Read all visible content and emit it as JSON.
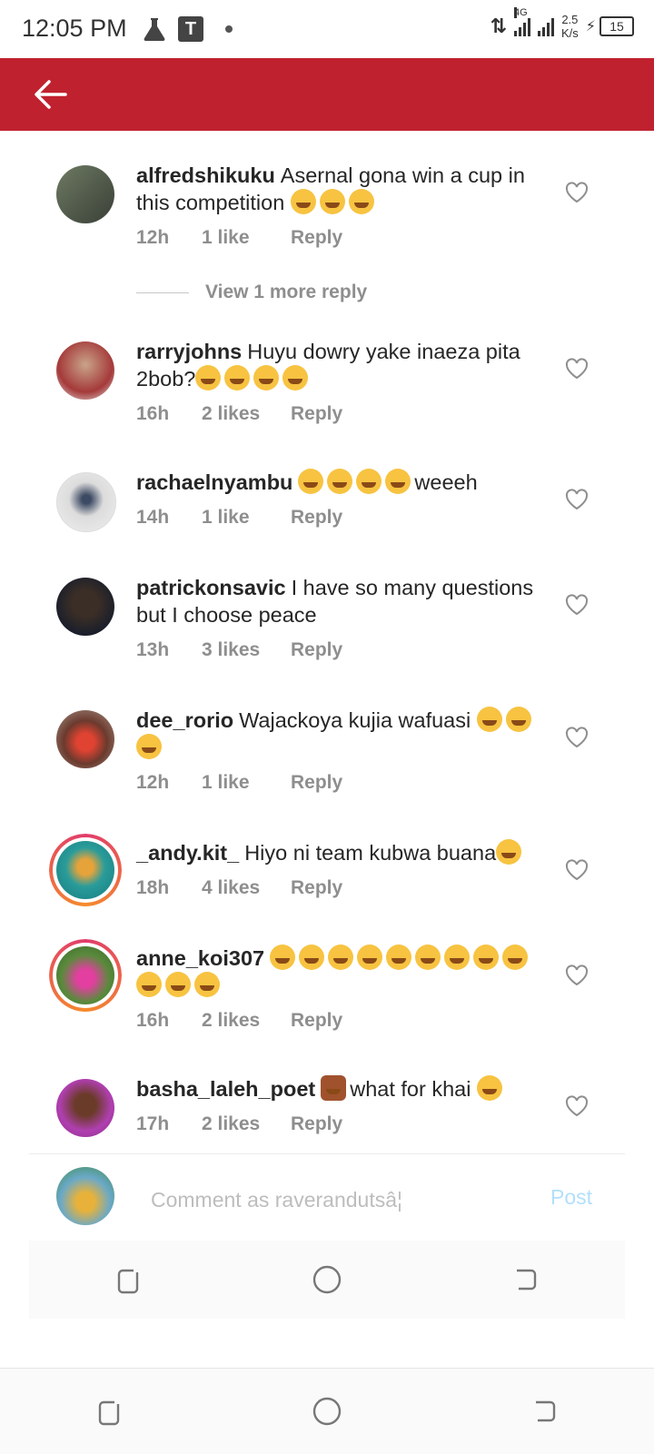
{
  "status_bar": {
    "time": "12:05 PM",
    "network": "4G",
    "speed_value": "2.5",
    "speed_unit": "K/s",
    "battery": "15"
  },
  "header": {
    "back_icon": "arrow-left-icon",
    "background": "#c0212f"
  },
  "comments": [
    {
      "username": "alfredshikuku",
      "text": "Asernal gona win a cup in this competition",
      "emoji_count": 3,
      "time": "12h",
      "likes": "1 like",
      "reply": "Reply"
    },
    {
      "username": "rarryjohns",
      "text": "Huyu dowry yake inaeza pita 2bob?",
      "emoji_count": 4,
      "time": "16h",
      "likes": "2 likes",
      "reply": "Reply"
    },
    {
      "username": "rachaelnyambu",
      "text": "weeeh",
      "emoji_count": 4,
      "emoji_before": true,
      "time": "14h",
      "likes": "1 like",
      "reply": "Reply"
    },
    {
      "username": "patrickonsavic",
      "text": "I have so many questions but  I choose peace",
      "emoji_count": 0,
      "time": "13h",
      "likes": "3 likes",
      "reply": "Reply"
    },
    {
      "username": "dee_rorio",
      "text": "Wajackoya kujia wafuasi",
      "emoji_count": 3,
      "time": "12h",
      "likes": "1 like",
      "reply": "Reply"
    },
    {
      "username": "_andy.kit_",
      "text": "Hiyo ni team kubwa buana",
      "emoji_count": 1,
      "time": "18h",
      "likes": "4 likes",
      "reply": "Reply"
    },
    {
      "username": "anne_koi307",
      "text": "",
      "emoji_count": 12,
      "time": "16h",
      "likes": "2 likes",
      "reply": "Reply"
    },
    {
      "username": "basha_laleh_poet",
      "text": "what for khai",
      "emoji_count": 0,
      "time": "17h",
      "likes": "2 likes",
      "reply": "Reply"
    }
  ],
  "view_more_reply": "View 1 more reply",
  "composer": {
    "placeholder": "Comment as raverandutsâ¦",
    "post_label": "Post"
  },
  "colors": {
    "accent": "#c0212f",
    "meta": "#8e8e8e",
    "post_disabled": "#b2dffc"
  },
  "nav": {
    "back": "back-nav-icon",
    "home": "home-nav-icon",
    "recents": "recents-nav-icon"
  }
}
